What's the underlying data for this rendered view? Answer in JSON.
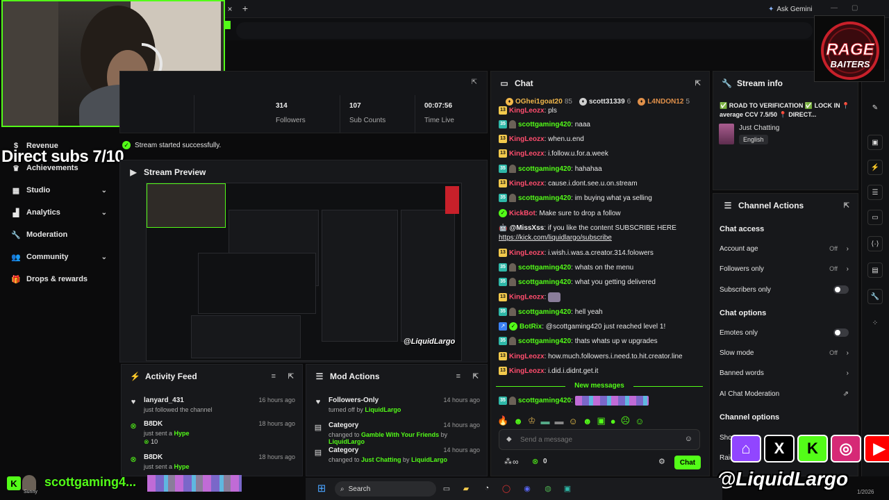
{
  "browser": {
    "ask_gemini": "Ask Gemini",
    "tab_close": "×",
    "tab_new": "+"
  },
  "overlay": {
    "direct_subs": "Direct subs 7/10",
    "social_handle": "@LiquidLargo",
    "bottom_sub_name": "scottgaming4...",
    "bottom_avatar_label": "Sunny",
    "bottom_badge": "K",
    "rage_logo_line1": "RAGE",
    "rage_logo_line2": "BAITERS"
  },
  "nav": {
    "items": [
      {
        "label": "Revenue",
        "icon": "dollar-icon"
      },
      {
        "label": "Achievements",
        "icon": "trophy-icon"
      },
      {
        "label": "Studio",
        "icon": "studio-icon",
        "chevron": true
      },
      {
        "label": "Analytics",
        "icon": "chart-icon",
        "chevron": true
      },
      {
        "label": "Moderation",
        "icon": "wrench-icon"
      },
      {
        "label": "Community",
        "icon": "people-icon",
        "chevron": true
      },
      {
        "label": "Drops & rewards",
        "icon": "gift-icon"
      }
    ]
  },
  "stats": [
    {
      "value": "314",
      "label": "Followers"
    },
    {
      "value": "107",
      "label": "Sub Counts"
    },
    {
      "value": "00:07:56",
      "label": "Time Live"
    }
  ],
  "toast": "Stream started successfully.",
  "preview": {
    "title": "Stream Preview"
  },
  "activity": {
    "title": "Activity Feed",
    "items": [
      {
        "name": "lanyard_431",
        "time": "16 hours ago",
        "sub": "just followed the channel",
        "extra": ""
      },
      {
        "name": "B8DK",
        "time": "18 hours ago",
        "sub_pre": "just sent a ",
        "sub_hl": "Hype",
        "extra": "10"
      },
      {
        "name": "B8DK",
        "time": "18 hours ago",
        "sub_pre": "just sent a ",
        "sub_hl": "Hype",
        "extra": ""
      }
    ]
  },
  "mod_actions": {
    "title": "Mod Actions",
    "items": [
      {
        "name": "Followers-Only",
        "time": "14 hours ago",
        "sub_pre": "turned off by ",
        "sub_hl": "LiquidLargo"
      },
      {
        "name": "Category",
        "time": "14 hours ago",
        "sub_pre": "changed to ",
        "sub_hl": "Gamble With Your Friends",
        "sub_mid": " by ",
        "sub_hl2": "LiquidLargo"
      },
      {
        "name": "Category",
        "time": "14 hours ago",
        "sub_pre": "changed to ",
        "sub_hl": "Just Chatting",
        "sub_mid": " by ",
        "sub_hl2": "LiquidLargo"
      }
    ]
  },
  "chat": {
    "title": "Chat",
    "leaders": [
      {
        "name": "OGhei1goat20",
        "count": "85",
        "color": "#f2b84b"
      },
      {
        "name": "scott31339",
        "count": "6",
        "color": "#cfcfcf"
      },
      {
        "name": "L4NDON12",
        "count": "5",
        "color": "#e0904a"
      }
    ],
    "messages": [
      {
        "badge": "13",
        "user": "KingLeozx",
        "color": "red",
        "text": "pls"
      },
      {
        "badge": "35",
        "avatar": true,
        "user": "scottgaming420",
        "color": "green",
        "text": "naaa"
      },
      {
        "badge": "13",
        "user": "KingLeozx",
        "color": "red",
        "text": "when.u.end"
      },
      {
        "badge": "13",
        "user": "KingLeozx",
        "color": "red",
        "text": "i.follow.u.for.a.week"
      },
      {
        "badge": "35",
        "avatar": true,
        "user": "scottgaming420",
        "color": "green",
        "text": "hahahaa"
      },
      {
        "badge": "13",
        "user": "KingLeozx",
        "color": "red",
        "text": "cause.i.dont.see.u.on.stream"
      },
      {
        "badge": "35",
        "avatar": true,
        "user": "scottgaming420",
        "color": "green",
        "text": "im buying what ya selling"
      },
      {
        "badge": "bot",
        "user": "KickBot",
        "color": "red",
        "text": "Make sure to drop a follow"
      },
      {
        "badge": "robot",
        "user": "@MissXss",
        "color": "white",
        "text": "if you like the content SUBSCRIBE HERE",
        "link": "https://kick.com/liquidlargo/subscribe"
      },
      {
        "badge": "13",
        "user": "KingLeozx",
        "color": "red",
        "text": "i.wish.i.was.a.creator.314.folowers"
      },
      {
        "badge": "35",
        "avatar": true,
        "user": "scottgaming420",
        "color": "green",
        "text": "whats on the menu"
      },
      {
        "badge": "35",
        "avatar": true,
        "user": "scottgaming420",
        "color": "green",
        "text": "what you getting delivered"
      },
      {
        "badge": "13",
        "user": "KingLeozx",
        "color": "red",
        "text": ""
      },
      {
        "badge": "35",
        "avatar": true,
        "user": "scottgaming420",
        "color": "green",
        "text": "hell yeah"
      },
      {
        "badge": "botrix",
        "user": "BotRix",
        "color": "green",
        "text": "@scottgaming420 just reached level 1!"
      },
      {
        "badge": "35",
        "avatar": true,
        "user": "scottgaming420",
        "color": "green",
        "text": "thats whats up w upgrades"
      },
      {
        "badge": "13",
        "user": "KingLeozx",
        "color": "red",
        "text": "how.much.followers.i.need.to.hit.creator.line"
      },
      {
        "badge": "13",
        "user": "KingLeozx",
        "color": "red",
        "text": "i.did.i.didnt.get.it"
      }
    ],
    "new_messages": "New messages",
    "last_message": {
      "badge": "35",
      "user": "scottgaming420",
      "text": ""
    },
    "input_placeholder": "Send a message",
    "footer_infinity": "∞",
    "footer_points": "0",
    "send_label": "Chat"
  },
  "stream_info": {
    "title": "Stream info",
    "stream_title": "✅ ROAD TO VERIFICATION ✅ LOCK IN 📍 average CCV 7.5/50 📍 DIRECT...",
    "category": "Just Chatting",
    "language": "English"
  },
  "channel_actions": {
    "title": "Channel Actions",
    "chat_access": "Chat access",
    "account_age": {
      "label": "Account age",
      "value": "Off"
    },
    "followers_only": {
      "label": "Followers only",
      "value": "Off"
    },
    "subscribers_only": {
      "label": "Subscribers only"
    },
    "chat_options": "Chat options",
    "emotes_only": {
      "label": "Emotes only"
    },
    "slow_mode": {
      "label": "Slow mode",
      "value": "Off"
    },
    "banned_words": {
      "label": "Banned words"
    },
    "ai_mod": {
      "label": "AI Chat Moderation"
    },
    "channel_options": "Channel options",
    "show_label": "Show",
    "raid_label": "Raid"
  },
  "taskbar": {
    "search": "Search",
    "date": "1/2026"
  }
}
